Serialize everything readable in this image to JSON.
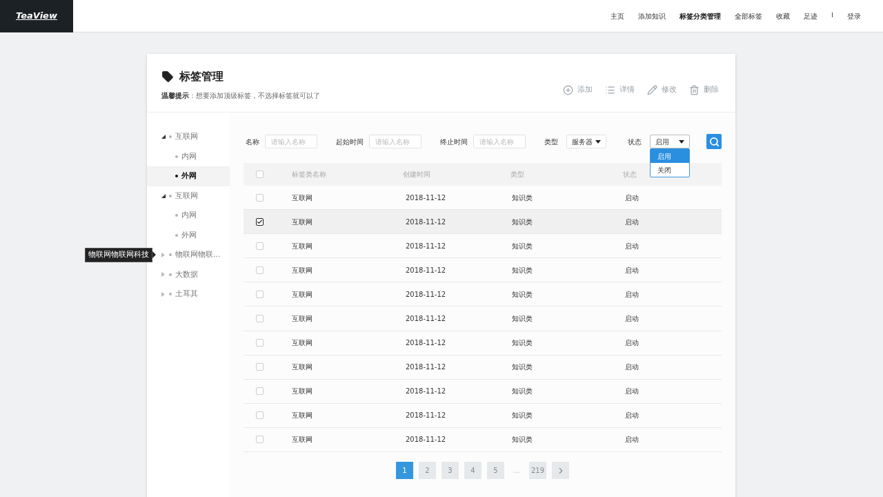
{
  "logo": "TeaView",
  "nav": [
    {
      "label": "主页",
      "selected": false
    },
    {
      "label": "添加知识",
      "selected": false
    },
    {
      "label": "标签分类管理",
      "selected": true
    },
    {
      "label": "全部标签",
      "selected": false
    },
    {
      "label": "收藏",
      "selected": false
    },
    {
      "label": "足迹",
      "selected": false
    }
  ],
  "nav_separator": "I",
  "login": "登录",
  "page": {
    "title": "标签管理",
    "hint_label": "温馨提示",
    "hint": "：想要添加顶级标签，不选择标签就可以了"
  },
  "actions": [
    {
      "kind": "add",
      "label": "添加"
    },
    {
      "kind": "details",
      "label": "详情"
    },
    {
      "kind": "edit",
      "label": "修改"
    },
    {
      "kind": "delete",
      "label": "删除"
    }
  ],
  "tree": [
    {
      "label": "互联网",
      "expanded": true,
      "selected": false,
      "children": [
        {
          "label": "内网",
          "selected": false
        },
        {
          "label": "外网",
          "selected": true
        }
      ]
    },
    {
      "label": "互联网",
      "expanded": true,
      "selected": false,
      "children": [
        {
          "label": "内网",
          "selected": false
        },
        {
          "label": "外网",
          "selected": false
        }
      ]
    },
    {
      "label": "物联网物联...",
      "expanded": false,
      "selected": false,
      "tooltip": "物联网物联网科技"
    },
    {
      "label": "大数据",
      "expanded": false,
      "selected": false
    },
    {
      "label": "土耳其",
      "expanded": false,
      "selected": false
    }
  ],
  "filters": [
    {
      "kind": "input",
      "label": "名称",
      "placeholder": "请输入名称"
    },
    {
      "kind": "input",
      "label": "起始时间",
      "placeholder": "请输入名称"
    },
    {
      "kind": "input",
      "label": "终止时间",
      "placeholder": "请输入名称"
    },
    {
      "kind": "select",
      "label": "类型",
      "value": "服务器"
    },
    {
      "kind": "select",
      "label": "状态",
      "value": "启用",
      "expanded": true,
      "options": [
        {
          "label": "启用",
          "selected": true
        },
        {
          "label": "关闭",
          "selected": false
        }
      ]
    }
  ],
  "table": {
    "header_checked": false,
    "columns": [
      "标签类名称",
      "创建时间",
      "类型",
      "状态"
    ],
    "rows": [
      {
        "checked": false,
        "cells": [
          "互联网",
          "2018-11-12",
          "知识类",
          "启动"
        ]
      },
      {
        "checked": true,
        "cells": [
          "互联网",
          "2018-11-12",
          "知识类",
          "启动"
        ]
      },
      {
        "checked": false,
        "cells": [
          "互联网",
          "2018-11-12",
          "知识类",
          "启动"
        ]
      },
      {
        "checked": false,
        "cells": [
          "互联网",
          "2018-11-12",
          "知识类",
          "启动"
        ]
      },
      {
        "checked": false,
        "cells": [
          "互联网",
          "2018-11-12",
          "知识类",
          "启动"
        ]
      },
      {
        "checked": false,
        "cells": [
          "互联网",
          "2018-11-12",
          "知识类",
          "启动"
        ]
      },
      {
        "checked": false,
        "cells": [
          "互联网",
          "2018-11-12",
          "知识类",
          "启动"
        ]
      },
      {
        "checked": false,
        "cells": [
          "互联网",
          "2018-11-12",
          "知识类",
          "启动"
        ]
      },
      {
        "checked": false,
        "cells": [
          "互联网",
          "2018-11-12",
          "知识类",
          "启动"
        ]
      },
      {
        "checked": false,
        "cells": [
          "互联网",
          "2018-11-12",
          "知识类",
          "启动"
        ]
      },
      {
        "checked": false,
        "cells": [
          "互联网",
          "2018-11-12",
          "知识类",
          "启动"
        ]
      }
    ]
  },
  "pagination": {
    "pages": [
      {
        "label": "1",
        "selected": true
      },
      {
        "label": "2",
        "selected": false
      },
      {
        "label": "3",
        "selected": false
      },
      {
        "label": "4",
        "selected": false
      },
      {
        "label": "5",
        "selected": false
      }
    ],
    "ellipsis": "...",
    "last": {
      "label": "219",
      "selected": false
    }
  }
}
